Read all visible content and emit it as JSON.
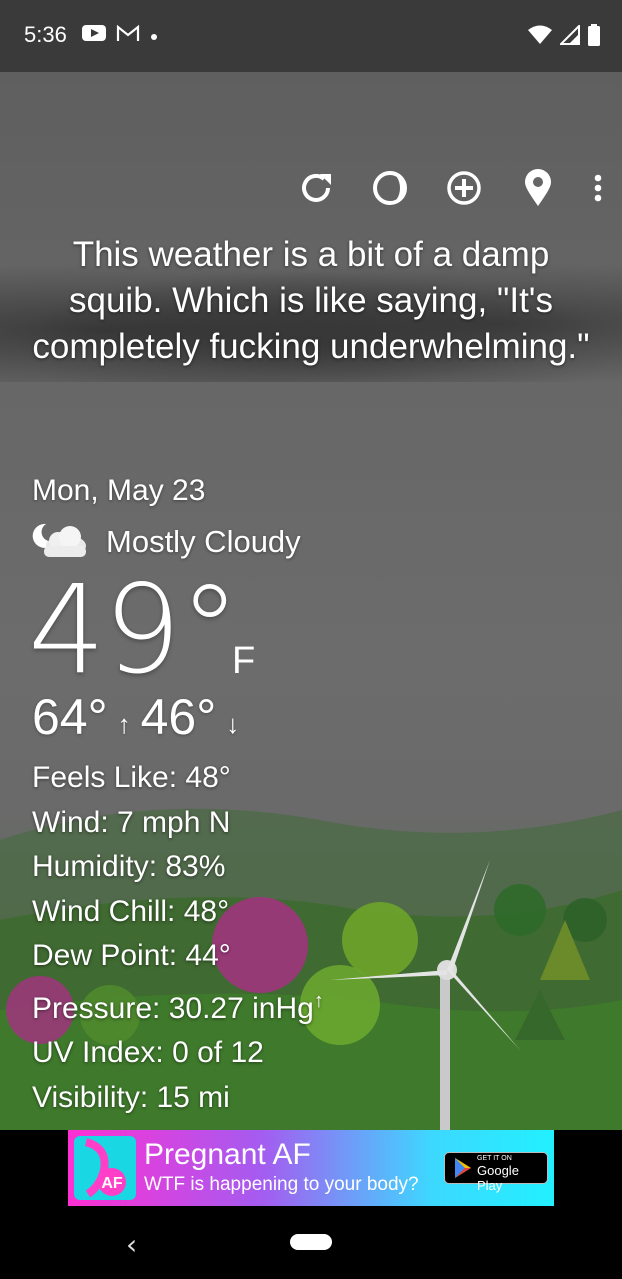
{
  "status_bar": {
    "time": "5:36",
    "icons_left": [
      "youtube-icon",
      "gmail-icon",
      "dot-icon"
    ],
    "icons_right": [
      "wifi-icon",
      "signal-icon",
      "battery-icon"
    ]
  },
  "toolbar": {
    "icons": [
      "refresh-icon",
      "theme-icon",
      "add-location-icon",
      "location-pin-icon",
      "more-menu-icon"
    ]
  },
  "quote": "This weather is a bit of a damp squib. Which is like saying, \"It's completely fucking underwhelming.\"",
  "current": {
    "date": "Mon, May 23",
    "condition": "Mostly Cloudy",
    "condition_icon": "partly-cloudy-night-icon",
    "temperature": "49°",
    "unit": "F",
    "high": "64°",
    "high_arrow": "↑",
    "low": "46°",
    "low_arrow": "↓"
  },
  "details": {
    "feels_like": "Feels Like:  48°",
    "wind": "Wind:  7 mph N",
    "humidity": "Humidity:  83%",
    "wind_chill": "Wind Chill:  48°",
    "dew_point": "Dew Point:  44°",
    "pressure": "Pressure:  30.27 inHg",
    "pressure_trend": "↑",
    "uv_index": "UV Index:  0 of 12",
    "visibility": "Visibility:  15 mi"
  },
  "ad": {
    "title": "Pregnant AF",
    "subtitle": "WTF is happening to your body?",
    "logo_text": "AF",
    "store_small": "GET IT ON",
    "store_big": "Google Play"
  },
  "nav": {
    "back": "‹"
  }
}
